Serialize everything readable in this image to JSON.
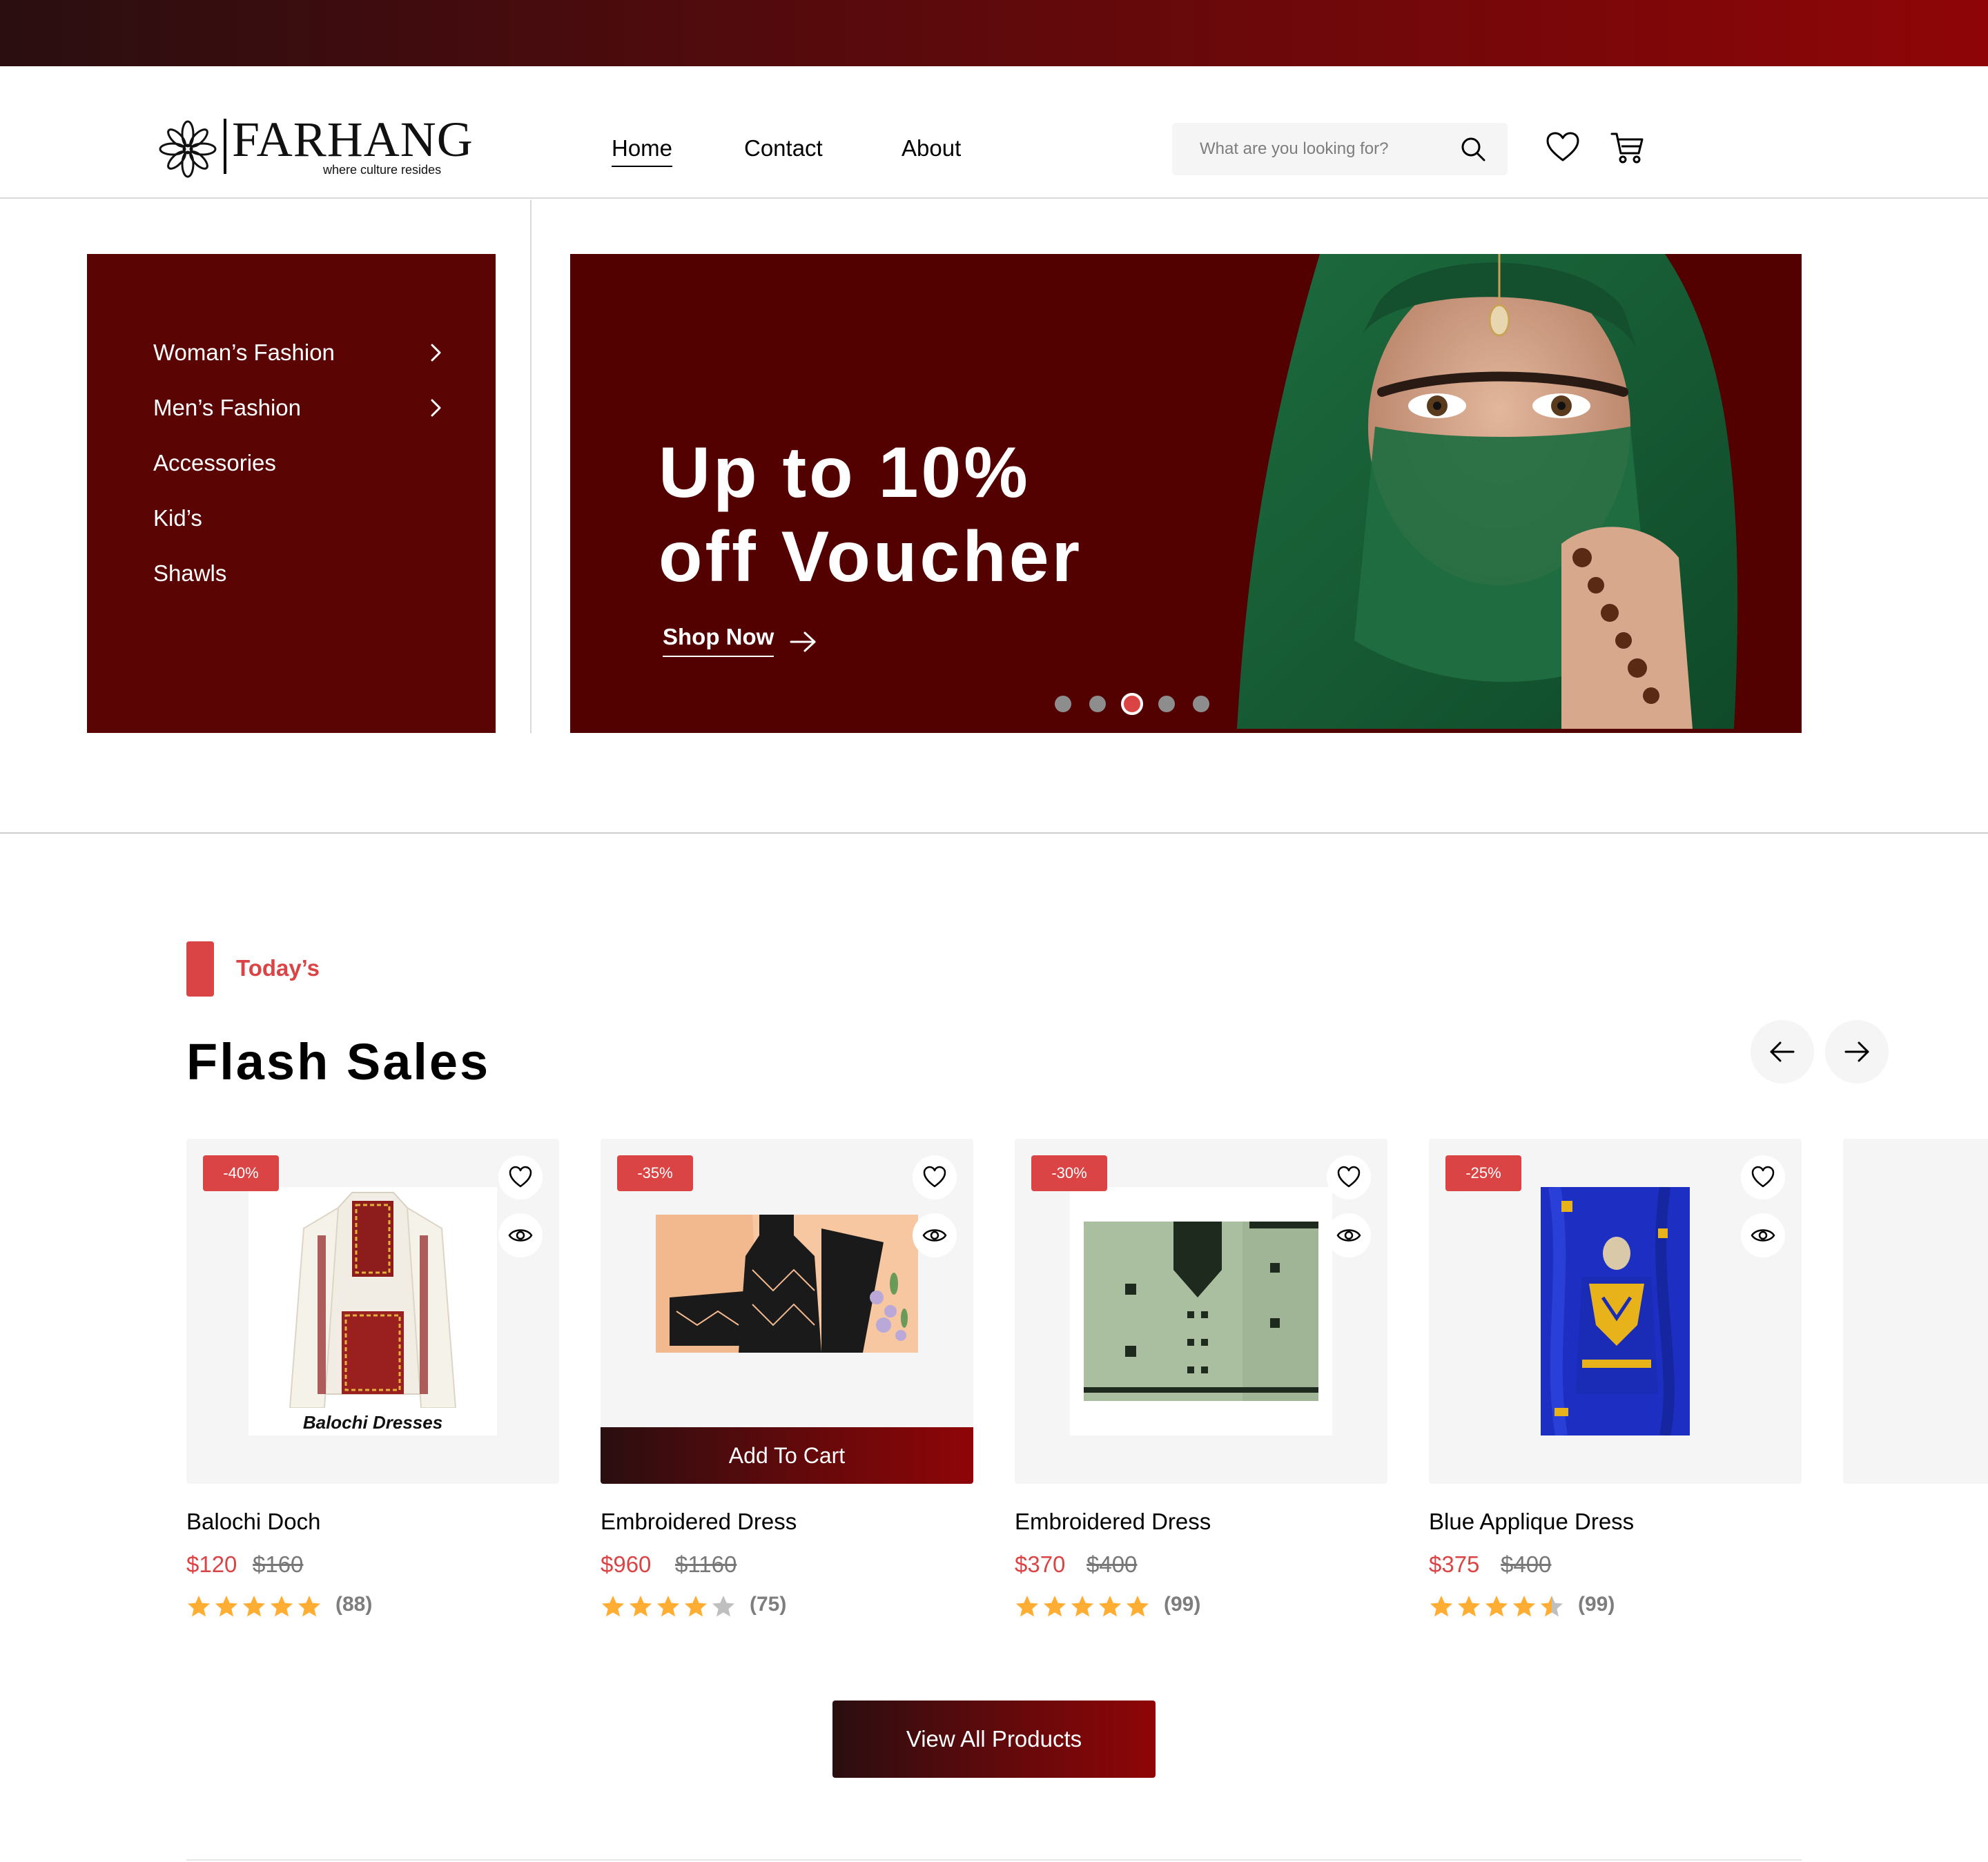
{
  "brand": {
    "name": "FARHANG",
    "tagline": "where culture resides"
  },
  "nav": {
    "items": [
      "Home",
      "Contact",
      "About"
    ],
    "active": "Home"
  },
  "search": {
    "placeholder": "What are you looking for?"
  },
  "sidebar": {
    "items": [
      {
        "label": "Woman’s Fashion",
        "has_submenu": true
      },
      {
        "label": "Men’s Fashion",
        "has_submenu": true
      },
      {
        "label": "Accessories",
        "has_submenu": false
      },
      {
        "label": "Kid’s",
        "has_submenu": false
      },
      {
        "label": "Shawls",
        "has_submenu": false
      }
    ]
  },
  "hero": {
    "title_line1": "Up to 10%",
    "title_line2": "off Voucher",
    "cta": "Shop Now",
    "slides_total": 5,
    "active_slide": 3
  },
  "flash": {
    "tag": "Today’s",
    "title": "Flash Sales",
    "add_to_cart": "Add To Cart",
    "view_all": "View All Products",
    "products": [
      {
        "discount": "-40%",
        "name": "Balochi Doch",
        "price": "$120",
        "old_price": "$160",
        "rating": 5,
        "reviews": "(88)",
        "image_caption": "Balochi Dresses"
      },
      {
        "discount": "-35%",
        "name": "Embroidered Dress",
        "price": "$960",
        "old_price": "$1160",
        "rating": 4,
        "reviews": "(75)"
      },
      {
        "discount": "-30%",
        "name": "Embroidered Dress",
        "price": "$370",
        "old_price": "$400",
        "rating": 5,
        "reviews": "(99)"
      },
      {
        "discount": "-25%",
        "name": "Blue Applique Dress",
        "price": "$375",
        "old_price": "$400",
        "rating": 4.5,
        "reviews": "(99)"
      }
    ]
  },
  "colors": {
    "accent": "#db4444",
    "brand_dark": "#5b0404",
    "star": "#ffad33"
  }
}
